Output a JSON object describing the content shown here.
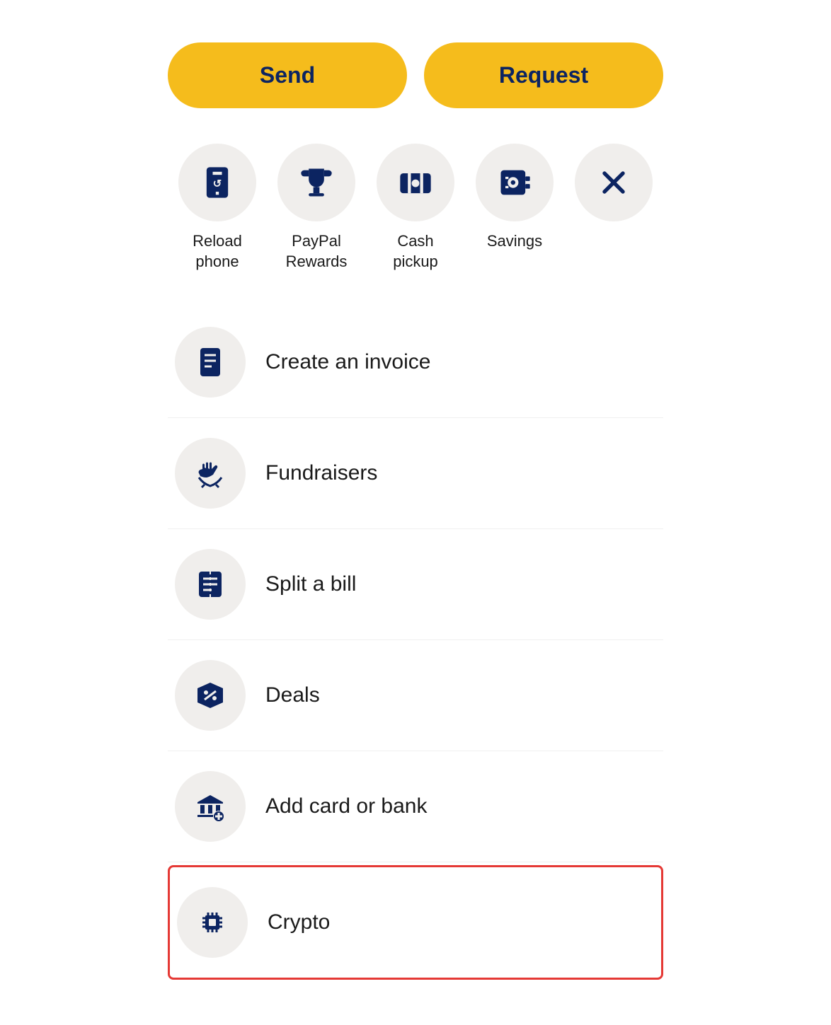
{
  "buttons": {
    "send_label": "Send",
    "request_label": "Request"
  },
  "quick_actions": [
    {
      "id": "reload-phone",
      "label": "Reload\nphone",
      "icon": "phone-reload"
    },
    {
      "id": "paypal-rewards",
      "label": "PayPal\nRewards",
      "icon": "trophy"
    },
    {
      "id": "cash-pickup",
      "label": "Cash\npickup",
      "icon": "cash-pickup"
    },
    {
      "id": "savings",
      "label": "Savings",
      "icon": "safe"
    },
    {
      "id": "close",
      "label": "",
      "icon": "close"
    }
  ],
  "list_items": [
    {
      "id": "create-invoice",
      "label": "Create an invoice",
      "icon": "invoice",
      "highlighted": false
    },
    {
      "id": "fundraisers",
      "label": "Fundraisers",
      "icon": "fundraisers",
      "highlighted": false
    },
    {
      "id": "split-bill",
      "label": "Split a bill",
      "icon": "split-bill",
      "highlighted": false
    },
    {
      "id": "deals",
      "label": "Deals",
      "icon": "deals",
      "highlighted": false
    },
    {
      "id": "add-card-bank",
      "label": "Add card or bank",
      "icon": "add-bank",
      "highlighted": false
    },
    {
      "id": "crypto",
      "label": "Crypto",
      "icon": "crypto",
      "highlighted": true
    }
  ]
}
